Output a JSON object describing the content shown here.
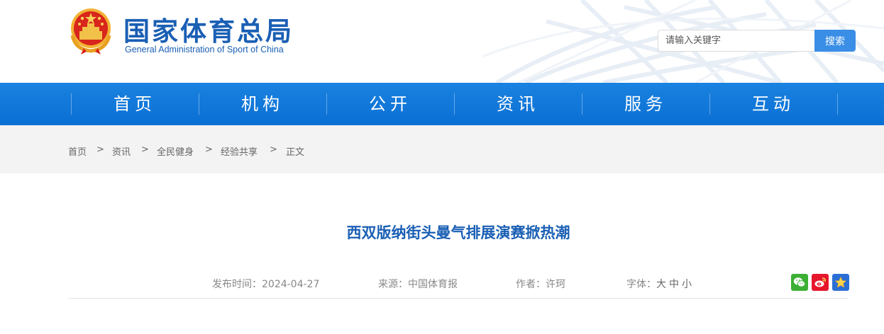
{
  "header": {
    "site_title": "国家体育总局",
    "site_subtitle": "General Administration of Sport of China",
    "search": {
      "placeholder": "请输入关键字",
      "button_label": "搜索"
    }
  },
  "nav": {
    "items": [
      {
        "label": "首页"
      },
      {
        "label": "机构"
      },
      {
        "label": "公开"
      },
      {
        "label": "资讯"
      },
      {
        "label": "服务"
      },
      {
        "label": "互动"
      }
    ]
  },
  "breadcrumb": {
    "items": [
      "首页",
      "资讯",
      "全民健身",
      "经验共享",
      "正文"
    ],
    "separator": ">"
  },
  "article": {
    "title": "西双版纳街头曼气排展演赛掀热潮",
    "publish_time": "发布时间：2024-04-27",
    "source": "来源：中国体育报",
    "author": "作者：许珂",
    "font_label": "字体：",
    "font_sizes": [
      "大",
      "中",
      "小"
    ]
  },
  "share": {
    "icons": [
      "wechat-icon",
      "weibo-icon",
      "favorite-star-icon"
    ],
    "colors": {
      "wechat": "#3cb034",
      "weibo": "#e6162d",
      "star": "#2a6fd6"
    }
  },
  "colors": {
    "brand_blue": "#1a5fb4",
    "nav_blue": "#0a6fd4",
    "search_button": "#3a8ee6"
  }
}
